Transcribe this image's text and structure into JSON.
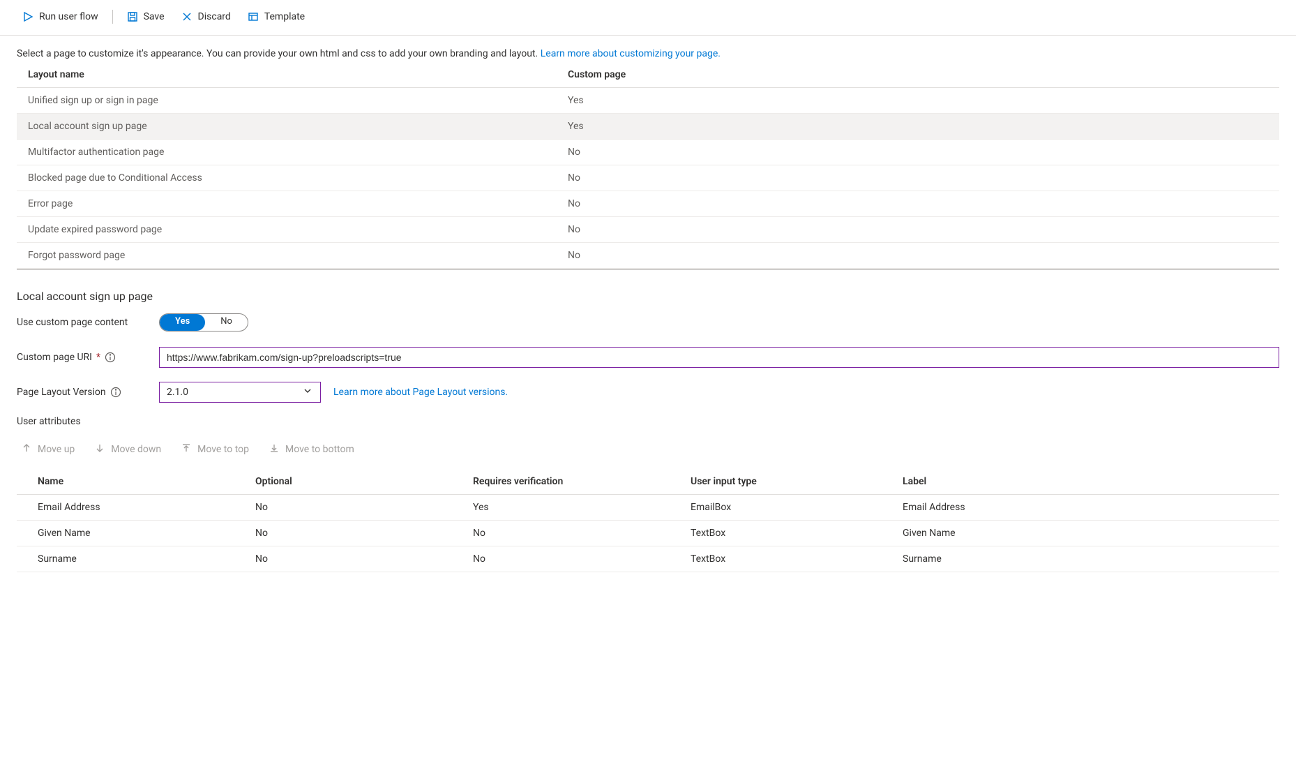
{
  "toolbar": {
    "run": "Run user flow",
    "save": "Save",
    "discard": "Discard",
    "template": "Template"
  },
  "intro": {
    "text": "Select a page to customize it's appearance. You can provide your own html and css to add your own branding and layout. ",
    "link": "Learn more about customizing your page."
  },
  "layouts_header": {
    "name": "Layout name",
    "custom": "Custom page"
  },
  "layouts": [
    {
      "name": "Unified sign up or sign in page",
      "custom": "Yes",
      "selected": false
    },
    {
      "name": "Local account sign up page",
      "custom": "Yes",
      "selected": true
    },
    {
      "name": "Multifactor authentication page",
      "custom": "No",
      "selected": false
    },
    {
      "name": "Blocked page due to Conditional Access",
      "custom": "No",
      "selected": false
    },
    {
      "name": "Error page",
      "custom": "No",
      "selected": false
    },
    {
      "name": "Update expired password page",
      "custom": "No",
      "selected": false
    },
    {
      "name": "Forgot password page",
      "custom": "No",
      "selected": false
    }
  ],
  "detail": {
    "title": "Local account sign up page",
    "use_custom_label": "Use custom page content",
    "toggle_yes": "Yes",
    "toggle_no": "No",
    "uri_label": "Custom page URI",
    "uri_value": "https://www.fabrikam.com/sign-up?preloadscripts=true",
    "version_label": "Page Layout Version",
    "version_value": "2.1.0",
    "version_link": "Learn more about Page Layout versions.",
    "ua_heading": "User attributes",
    "ua_toolbar": {
      "up": "Move up",
      "down": "Move down",
      "top": "Move to top",
      "bottom": "Move to bottom"
    },
    "ua_header": {
      "name": "Name",
      "optional": "Optional",
      "requires": "Requires verification",
      "type": "User input type",
      "label": "Label"
    },
    "ua_rows": [
      {
        "name": "Email Address",
        "optional": "No",
        "requires": "Yes",
        "type": "EmailBox",
        "label": "Email Address"
      },
      {
        "name": "Given Name",
        "optional": "No",
        "requires": "No",
        "type": "TextBox",
        "label": "Given Name"
      },
      {
        "name": "Surname",
        "optional": "No",
        "requires": "No",
        "type": "TextBox",
        "label": "Surname"
      }
    ]
  }
}
